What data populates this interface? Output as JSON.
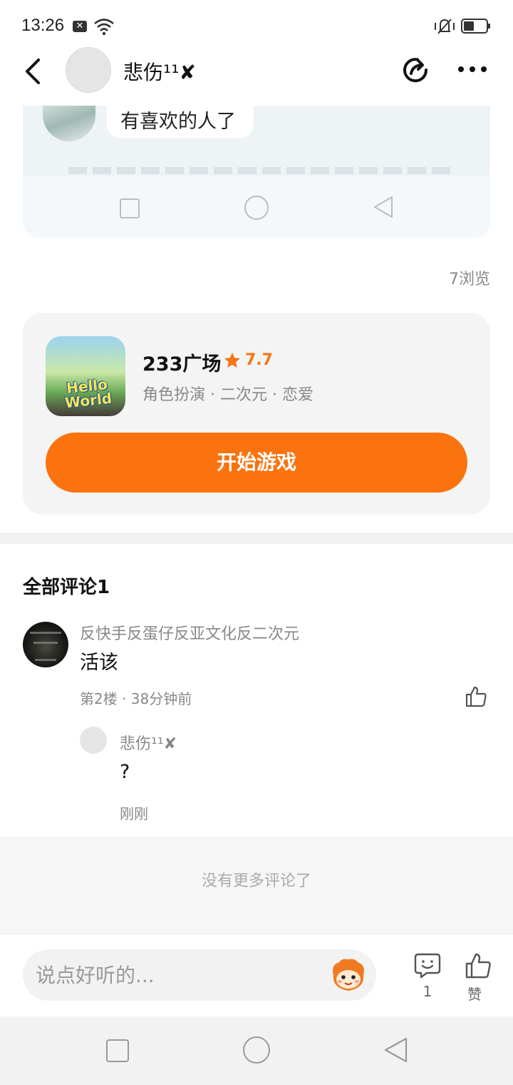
{
  "status_bar": {
    "time": "13:26",
    "notification_badge": "✕",
    "icons": [
      "wifi-icon",
      "bell-muted-icon",
      "battery-icon"
    ]
  },
  "header": {
    "username": "悲伤¹¹✘",
    "icons": [
      "back-icon",
      "share-icon",
      "more-icon"
    ]
  },
  "embedded_screenshot": {
    "bubble_text": "有喜欢的人了"
  },
  "post": {
    "views": "7浏览"
  },
  "game_card": {
    "icon_text": "Hello World",
    "title": "233广场",
    "rating": "7.7",
    "tags": "角色扮演 · 二次元 · 恋爱",
    "start_button": "开始游戏",
    "colors": {
      "accent": "#fa730f",
      "rating": "#f47513"
    }
  },
  "comments": {
    "title": "全部评论1",
    "items": [
      {
        "author": "反快手反蛋仔反亚文化反二次元",
        "text": "活该",
        "meta": "第2楼 · 38分钟前",
        "replies": [
          {
            "author": "悲伤¹¹✘",
            "text": "?",
            "time": "刚刚"
          }
        ]
      }
    ],
    "no_more": "没有更多评论了"
  },
  "bottom_bar": {
    "input_placeholder": "说点好听的...",
    "comment_count": "1",
    "like_label": "赞"
  }
}
